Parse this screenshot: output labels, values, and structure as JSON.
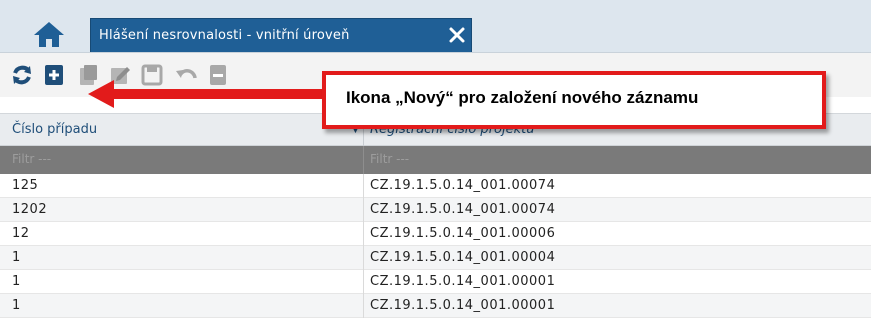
{
  "tab": {
    "title": "Hlášení nesrovnalosti - vnitřní úroveň"
  },
  "toolbar": {
    "buttons": [
      "refresh-icon",
      "new-record-icon",
      "copy-icon",
      "edit-icon",
      "save-icon",
      "undo-icon",
      "delete-icon"
    ]
  },
  "table": {
    "headers": [
      "Číslo případu",
      "Registrační číslo projektu"
    ],
    "filter_placeholder": "Filtr ---",
    "rows": [
      [
        "125",
        "CZ.19.1.5.0.14_001.00074"
      ],
      [
        "1202",
        "CZ.19.1.5.0.14_001.00074"
      ],
      [
        "12",
        "CZ.19.1.5.0.14_001.00006"
      ],
      [
        "1",
        "CZ.19.1.5.0.14_001.00004"
      ],
      [
        "1",
        "CZ.19.1.5.0.14_001.00001"
      ],
      [
        "1",
        "CZ.19.1.5.0.14_001.00001"
      ]
    ]
  },
  "callout": {
    "text": "Ikona „Nový“ pro založení nového záznamu"
  },
  "colors": {
    "tab_bg": "#1f5f96",
    "callout_border": "#e21b1b",
    "filter_bg": "#7a7a7a"
  }
}
